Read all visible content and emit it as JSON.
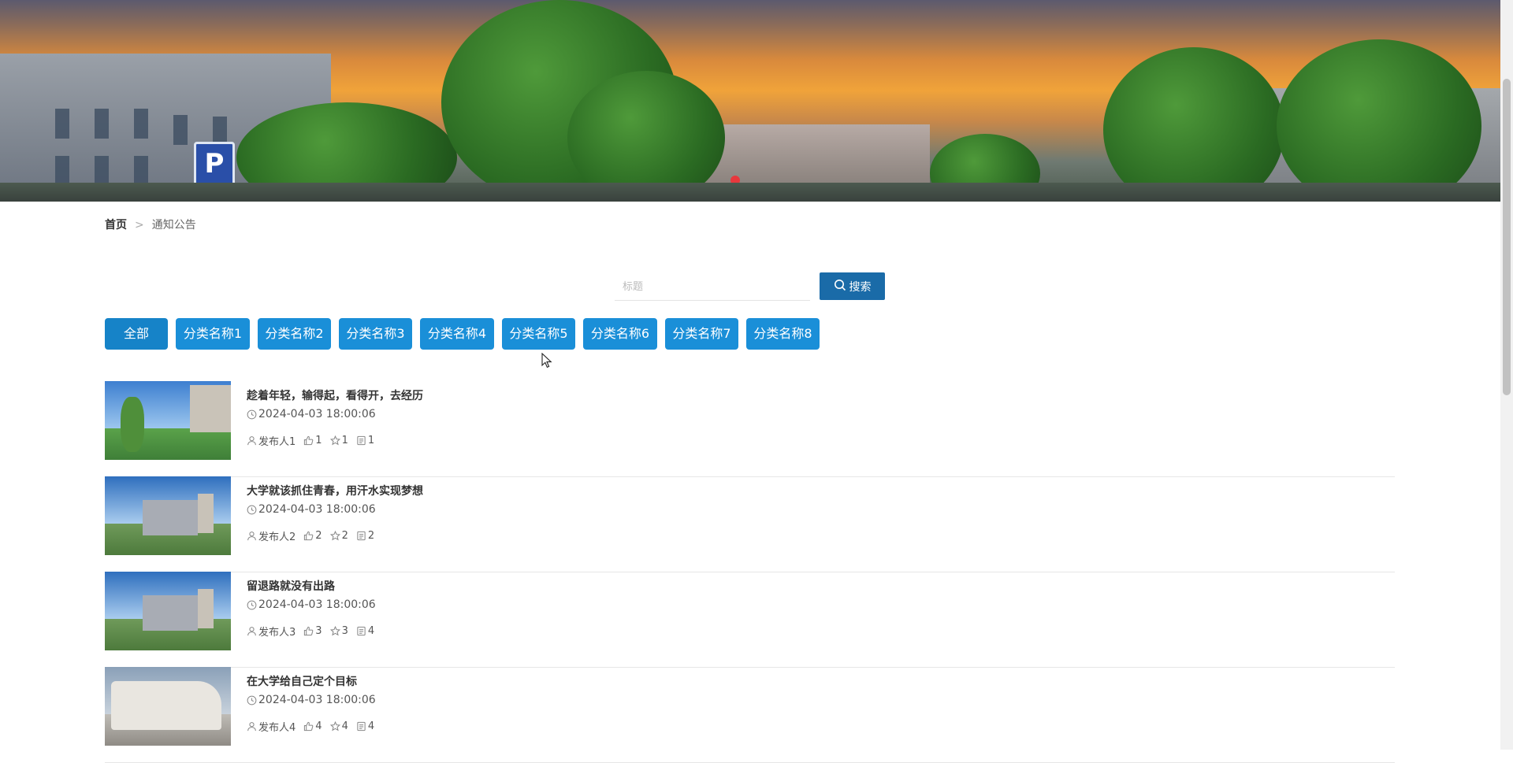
{
  "breadcrumb": {
    "home": "首页",
    "separator": ">",
    "current": "通知公告"
  },
  "search": {
    "placeholder": "标题",
    "value": "",
    "button_label": "搜索",
    "button_icon": "search-icon"
  },
  "categories": [
    {
      "label": "全部",
      "active": true
    },
    {
      "label": "分类名称1"
    },
    {
      "label": "分类名称2"
    },
    {
      "label": "分类名称3"
    },
    {
      "label": "分类名称4"
    },
    {
      "label": "分类名称5"
    },
    {
      "label": "分类名称6"
    },
    {
      "label": "分类名称7"
    },
    {
      "label": "分类名称8"
    }
  ],
  "items": [
    {
      "title": "趁着年轻，输得起，看得开，去经历",
      "time": "2024-04-03 18:00:06",
      "author": "发布人1",
      "likes": "1",
      "favorites": "1",
      "comments": "1"
    },
    {
      "title": "大学就该抓住青春，用汗水实现梦想",
      "time": "2024-04-03 18:00:06",
      "author": "发布人2",
      "likes": "2",
      "favorites": "2",
      "comments": "2"
    },
    {
      "title": "留退路就没有出路",
      "time": "2024-04-03 18:00:06",
      "author": "发布人3",
      "likes": "3",
      "favorites": "3",
      "comments": "4"
    },
    {
      "title": "在大学给自己定个目标",
      "time": "2024-04-03 18:00:06",
      "author": "发布人4",
      "likes": "4",
      "favorites": "4",
      "comments": "4"
    }
  ],
  "colors": {
    "category_bg": "#1a8fd8",
    "search_button_bg": "#1a6ba8"
  }
}
